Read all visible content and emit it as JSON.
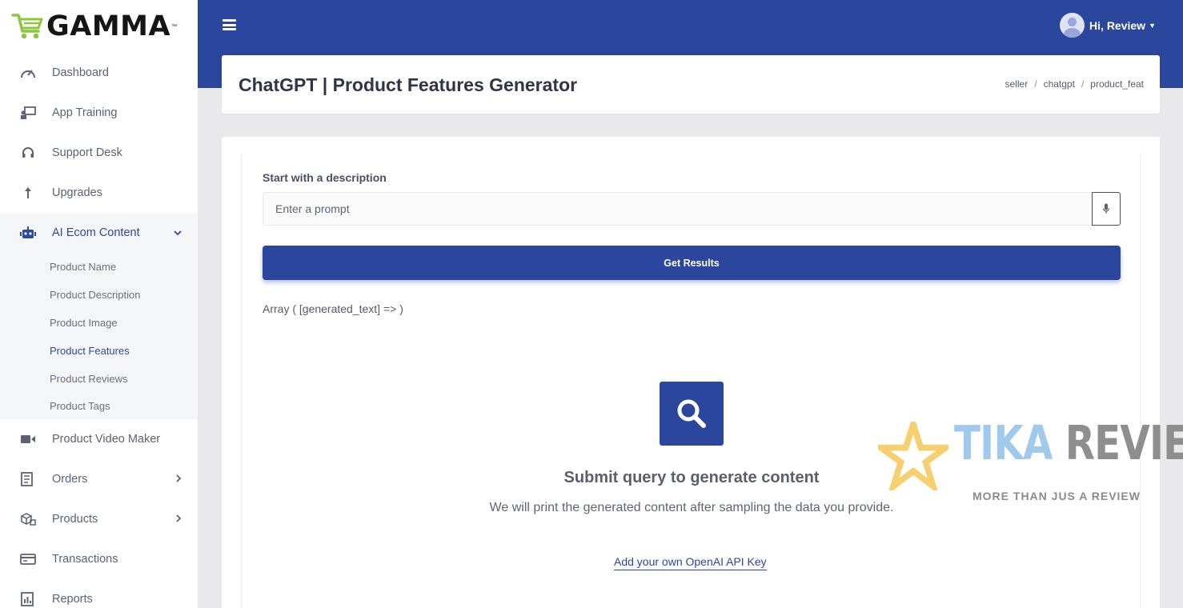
{
  "brand": {
    "name": "GAMMA",
    "tm": "™"
  },
  "sidebar": {
    "items": [
      {
        "label": "Dashboard",
        "icon": "speedometer-icon"
      },
      {
        "label": "App Training",
        "icon": "training-icon"
      },
      {
        "label": "Support Desk",
        "icon": "headset-icon"
      },
      {
        "label": "Upgrades",
        "icon": "arrow-up-icon"
      },
      {
        "label": "AI Ecom Content",
        "icon": "robot-icon",
        "expanded": true,
        "children": [
          "Product Name",
          "Product Description",
          "Product Image",
          "Product Features",
          "Product Reviews",
          "Product Tags"
        ],
        "current": "Product Features"
      },
      {
        "label": "Product Video Maker",
        "icon": "video-camera-icon"
      },
      {
        "label": "Orders",
        "icon": "orders-icon",
        "has_children": true
      },
      {
        "label": "Products",
        "icon": "boxes-icon",
        "has_children": true
      },
      {
        "label": "Transactions",
        "icon": "credit-card-icon"
      },
      {
        "label": "Reports",
        "icon": "report-icon"
      }
    ]
  },
  "topbar": {
    "greeting": "Hi, Review",
    "menu_icon": "hamburger-icon"
  },
  "header": {
    "title": "ChatGPT | Product Features Generator",
    "breadcrumb": [
      "seller",
      "chatgpt",
      "product_feat"
    ],
    "separator": "/"
  },
  "form": {
    "label": "Start with a description",
    "placeholder": "Enter a prompt",
    "value": "",
    "submit_label": "Get Results"
  },
  "result": {
    "raw_output": "Array ( [generated_text] => )"
  },
  "empty_state": {
    "title": "Submit query to generate content",
    "description": "We will print the generated content after sampling the data you provide.",
    "link": "Add your own OpenAI API Key"
  },
  "watermark": {
    "title_part1": "TIKA",
    "title_part2": " REVIEW",
    "tagline": "MORE THAN JUS A REVIEW"
  },
  "colors": {
    "primary": "#2b479d",
    "logo_green": "#8cc63f",
    "background": "#e9e9eb",
    "watermark_star": "#f6d06e"
  }
}
